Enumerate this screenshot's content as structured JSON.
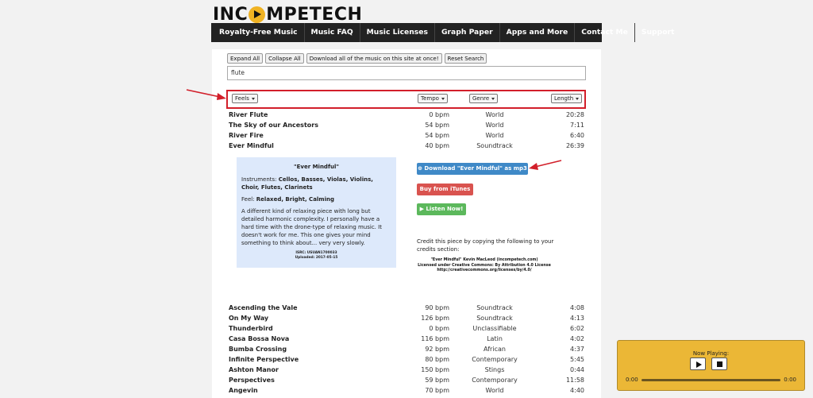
{
  "logo": {
    "prefix": "INC",
    "suffix": "MPETECH"
  },
  "nav": [
    "Royalty-Free Music",
    "Music FAQ",
    "Music Licenses",
    "Graph Paper",
    "Apps and More",
    "Contact Me",
    "Support"
  ],
  "buttons": {
    "expand": "Expand All",
    "collapse": "Collapse All",
    "download_all": "Download all of the music on this site at once!",
    "reset": "Reset Search"
  },
  "search": {
    "value": "flute"
  },
  "filters": {
    "feels": "Feels",
    "tempo": "Tempo",
    "genre": "Genre",
    "length": "Length"
  },
  "tracks_top": [
    {
      "title": "River Flute",
      "bpm": "0 bpm",
      "genre": "World",
      "length": "20:28"
    },
    {
      "title": "The Sky of our Ancestors",
      "bpm": "54 bpm",
      "genre": "World",
      "length": "7:11"
    },
    {
      "title": "River Fire",
      "bpm": "54 bpm",
      "genre": "World",
      "length": "6:40"
    },
    {
      "title": "Ever Mindful",
      "bpm": "40 bpm",
      "genre": "Soundtrack",
      "length": "26:39"
    }
  ],
  "detail": {
    "title": "\"Ever Mindful\"",
    "instruments_label": "Instruments: ",
    "instruments": "Cellos, Basses, Violas, Violins, Choir, Flutes, Clarinets",
    "feel_label": "Feel: ",
    "feel": "Relaxed, Bright, Calming",
    "description": "A different kind of relaxing piece with long but detailed harmonic complexity. I personally have a hard time with the drone-type of relaxing music. It doesn't work for me. This one gives your mind something to think about... very very slowly.",
    "isrc": "ISRC: USUAN1700033",
    "uploaded": "Uploaded: 2017-05-15",
    "download_btn": "Download \"Ever Mindful\" as mp3",
    "itunes_btn": "Buy from iTunes",
    "listen_btn": "Listen Now!",
    "credit_intro": "Credit this piece by copying the following to your credits section:",
    "credit_1": "\"Ever Mindful\" Kevin MacLeod (incompetech.com)",
    "credit_2": "Licensed under Creative Commons: By Attribution 4.0 License",
    "credit_3": "http://creativecommons.org/licenses/by/4.0/"
  },
  "tracks_bottom": [
    {
      "title": "Ascending the Vale",
      "bpm": "90 bpm",
      "genre": "Soundtrack",
      "length": "4:08"
    },
    {
      "title": "On My Way",
      "bpm": "126 bpm",
      "genre": "Soundtrack",
      "length": "4:13"
    },
    {
      "title": "Thunderbird",
      "bpm": "0 bpm",
      "genre": "Unclassifiable",
      "length": "6:02"
    },
    {
      "title": "Casa Bossa Nova",
      "bpm": "116 bpm",
      "genre": "Latin",
      "length": "4:02"
    },
    {
      "title": "Bumba Crossing",
      "bpm": "92 bpm",
      "genre": "African",
      "length": "4:37"
    },
    {
      "title": "Infinite Perspective",
      "bpm": "80 bpm",
      "genre": "Contemporary",
      "length": "5:45"
    },
    {
      "title": "Ashton Manor",
      "bpm": "150 bpm",
      "genre": "Stings",
      "length": "0:44"
    },
    {
      "title": "Perspectives",
      "bpm": "59 bpm",
      "genre": "Contemporary",
      "length": "11:58"
    },
    {
      "title": "Angevin",
      "bpm": "70 bpm",
      "genre": "World",
      "length": "4:40"
    }
  ],
  "player": {
    "label": "Now Playing:",
    "time_start": "0:00",
    "time_end": "0:00"
  },
  "colors": {
    "accent_red": "#d21f2a",
    "nav_bg": "#222222",
    "player_bg": "#ebb736",
    "info_bg": "#dde9fb"
  },
  "icons": {
    "logo_play": "play-circle-icon",
    "download": "download-icon",
    "listen": "play-icon"
  }
}
